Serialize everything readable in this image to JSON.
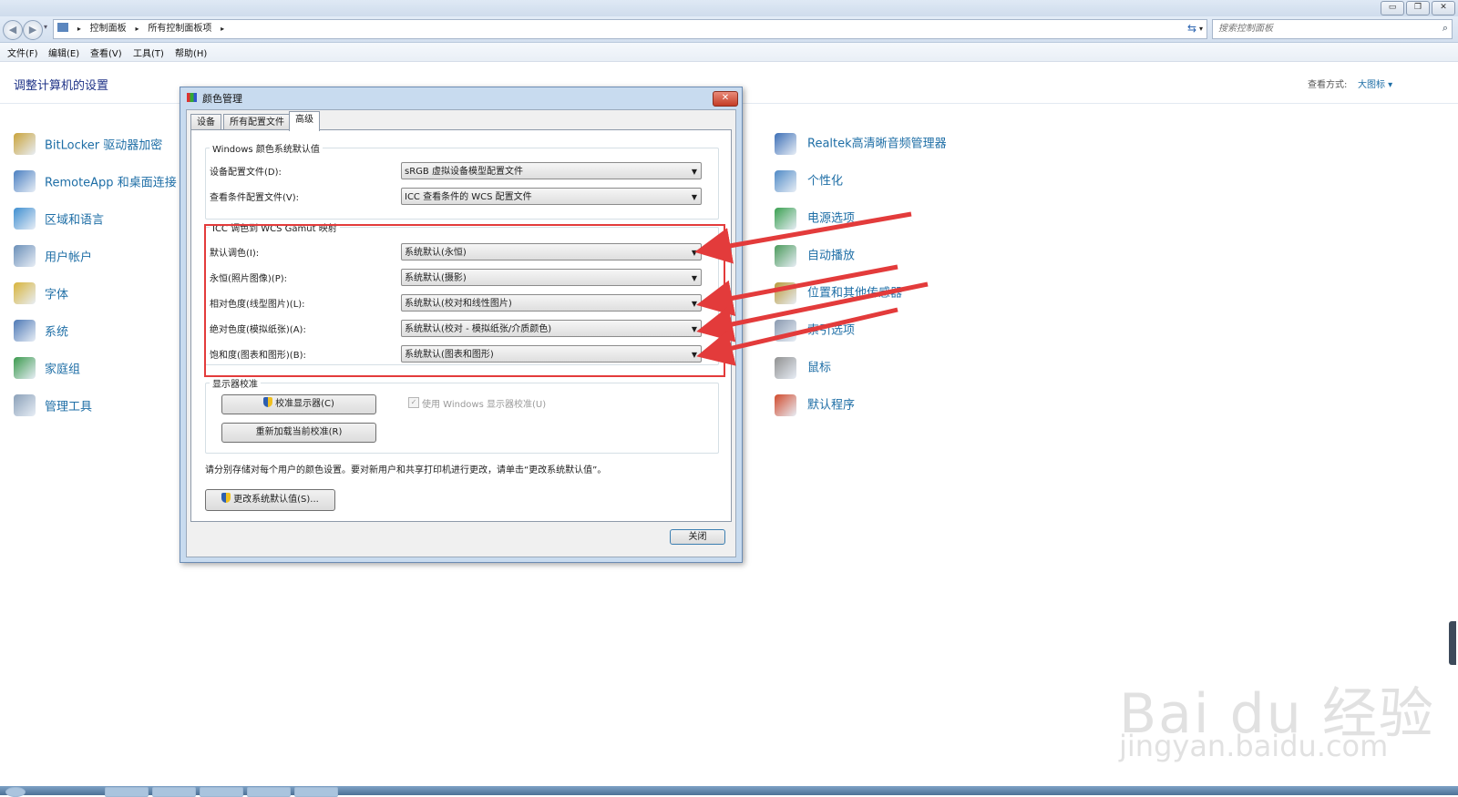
{
  "window": {
    "buttons": [
      "minimize",
      "restore",
      "close"
    ],
    "breadcrumb": [
      "控制面板",
      "所有控制面板项"
    ],
    "search_placeholder": "搜索控制面板"
  },
  "menu": [
    "文件(F)",
    "编辑(E)",
    "查看(V)",
    "工具(T)",
    "帮助(H)"
  ],
  "page_title": "调整计算机的设置",
  "view_by": {
    "label": "查看方式:",
    "value": "大图标 ▾"
  },
  "left_items": [
    {
      "label": "BitLocker 驱动器加密",
      "icon": "bitlocker-icon",
      "color": "#c9a33a"
    },
    {
      "label": "RemoteApp 和桌面连接",
      "icon": "remoteapp-icon",
      "color": "#4a7fc1"
    },
    {
      "label": "区域和语言",
      "icon": "globe-icon",
      "color": "#3f8fd0"
    },
    {
      "label": "用户帐户",
      "icon": "users-icon",
      "color": "#6a8fb8"
    },
    {
      "label": "字体",
      "icon": "fonts-icon",
      "color": "#d8b43a"
    },
    {
      "label": "系统",
      "icon": "system-icon",
      "color": "#4d78b5"
    },
    {
      "label": "家庭组",
      "icon": "homegroup-icon",
      "color": "#3b9a4d"
    },
    {
      "label": "管理工具",
      "icon": "admin-tools-icon",
      "color": "#8aa0b8"
    }
  ],
  "right_items": [
    {
      "label": "Realtek高清晰音频管理器",
      "icon": "realtek-audio-icon",
      "color": "#3d6fb6"
    },
    {
      "label": "个性化",
      "icon": "personalize-icon",
      "color": "#4f8ac6"
    },
    {
      "label": "电源选项",
      "icon": "power-icon",
      "color": "#3aa050"
    },
    {
      "label": "自动播放",
      "icon": "autoplay-icon",
      "color": "#4a9a5a"
    },
    {
      "label": "位置和其他传感器",
      "icon": "sensor-icon",
      "color": "#b99a3a"
    },
    {
      "label": "索引选项",
      "icon": "index-icon",
      "color": "#8a9ab0"
    },
    {
      "label": "鼠标",
      "icon": "mouse-icon",
      "color": "#909090"
    },
    {
      "label": "默认程序",
      "icon": "default-programs-icon",
      "color": "#d14a2c"
    }
  ],
  "dialog": {
    "title": "颜色管理",
    "tabs": [
      "设备",
      "所有配置文件",
      "高级"
    ],
    "active_tab": "高级",
    "windows_defaults": {
      "title": "Windows 颜色系统默认值",
      "rows": [
        {
          "label": "设备配置文件(D):",
          "value": "sRGB 虚拟设备模型配置文件"
        },
        {
          "label": "查看条件配置文件(V):",
          "value": "ICC 查看条件的 WCS 配置文件"
        }
      ]
    },
    "gamut": {
      "title": "ICC 调色到 WCS Gamut 映射",
      "rows": [
        {
          "label": "默认调色(I):",
          "value": "系统默认(永恒)"
        },
        {
          "label": "永恒(照片图像)(P):",
          "value": "系统默认(摄影)"
        },
        {
          "label": "相对色度(线型图片)(L):",
          "value": "系统默认(校对和线性图片)"
        },
        {
          "label": "绝对色度(模拟纸张)(A):",
          "value": "系统默认(校对 - 模拟纸张/介质颜色)"
        },
        {
          "label": "饱和度(图表和图形)(B):",
          "value": "系统默认(图表和图形)"
        }
      ]
    },
    "calibration": {
      "title": "显示器校准",
      "calibrate_button": "校准显示器(C)",
      "reload_button": "重新加载当前校准(R)",
      "checkbox_label": "使用 Windows 显示器校准(U)"
    },
    "note": "请分别存储对每个用户的颜色设置。要对新用户和共享打印机进行更改，请单击“更改系统默认值”。",
    "change_defaults_button": "更改系统默认值(S)...",
    "close_button": "关闭"
  },
  "colors": {
    "link": "#1e6ea6",
    "annotation_red": "#e33b3b",
    "dialog_frame": "#c8dbef"
  },
  "watermark": {
    "brand": "Bai du 经验",
    "url": "jingyan.baidu.com"
  }
}
